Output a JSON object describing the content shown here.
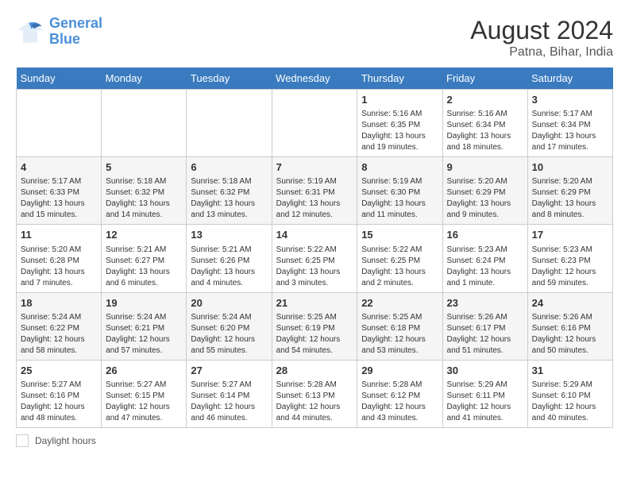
{
  "logo": {
    "line1": "General",
    "line2": "Blue"
  },
  "title": "August 2024",
  "location": "Patna, Bihar, India",
  "days_of_week": [
    "Sunday",
    "Monday",
    "Tuesday",
    "Wednesday",
    "Thursday",
    "Friday",
    "Saturday"
  ],
  "weeks": [
    [
      {
        "num": "",
        "info": ""
      },
      {
        "num": "",
        "info": ""
      },
      {
        "num": "",
        "info": ""
      },
      {
        "num": "",
        "info": ""
      },
      {
        "num": "1",
        "info": "Sunrise: 5:16 AM\nSunset: 6:35 PM\nDaylight: 13 hours and 19 minutes."
      },
      {
        "num": "2",
        "info": "Sunrise: 5:16 AM\nSunset: 6:34 PM\nDaylight: 13 hours and 18 minutes."
      },
      {
        "num": "3",
        "info": "Sunrise: 5:17 AM\nSunset: 6:34 PM\nDaylight: 13 hours and 17 minutes."
      }
    ],
    [
      {
        "num": "4",
        "info": "Sunrise: 5:17 AM\nSunset: 6:33 PM\nDaylight: 13 hours and 15 minutes."
      },
      {
        "num": "5",
        "info": "Sunrise: 5:18 AM\nSunset: 6:32 PM\nDaylight: 13 hours and 14 minutes."
      },
      {
        "num": "6",
        "info": "Sunrise: 5:18 AM\nSunset: 6:32 PM\nDaylight: 13 hours and 13 minutes."
      },
      {
        "num": "7",
        "info": "Sunrise: 5:19 AM\nSunset: 6:31 PM\nDaylight: 13 hours and 12 minutes."
      },
      {
        "num": "8",
        "info": "Sunrise: 5:19 AM\nSunset: 6:30 PM\nDaylight: 13 hours and 11 minutes."
      },
      {
        "num": "9",
        "info": "Sunrise: 5:20 AM\nSunset: 6:29 PM\nDaylight: 13 hours and 9 minutes."
      },
      {
        "num": "10",
        "info": "Sunrise: 5:20 AM\nSunset: 6:29 PM\nDaylight: 13 hours and 8 minutes."
      }
    ],
    [
      {
        "num": "11",
        "info": "Sunrise: 5:20 AM\nSunset: 6:28 PM\nDaylight: 13 hours and 7 minutes."
      },
      {
        "num": "12",
        "info": "Sunrise: 5:21 AM\nSunset: 6:27 PM\nDaylight: 13 hours and 6 minutes."
      },
      {
        "num": "13",
        "info": "Sunrise: 5:21 AM\nSunset: 6:26 PM\nDaylight: 13 hours and 4 minutes."
      },
      {
        "num": "14",
        "info": "Sunrise: 5:22 AM\nSunset: 6:25 PM\nDaylight: 13 hours and 3 minutes."
      },
      {
        "num": "15",
        "info": "Sunrise: 5:22 AM\nSunset: 6:25 PM\nDaylight: 13 hours and 2 minutes."
      },
      {
        "num": "16",
        "info": "Sunrise: 5:23 AM\nSunset: 6:24 PM\nDaylight: 13 hours and 1 minute."
      },
      {
        "num": "17",
        "info": "Sunrise: 5:23 AM\nSunset: 6:23 PM\nDaylight: 12 hours and 59 minutes."
      }
    ],
    [
      {
        "num": "18",
        "info": "Sunrise: 5:24 AM\nSunset: 6:22 PM\nDaylight: 12 hours and 58 minutes."
      },
      {
        "num": "19",
        "info": "Sunrise: 5:24 AM\nSunset: 6:21 PM\nDaylight: 12 hours and 57 minutes."
      },
      {
        "num": "20",
        "info": "Sunrise: 5:24 AM\nSunset: 6:20 PM\nDaylight: 12 hours and 55 minutes."
      },
      {
        "num": "21",
        "info": "Sunrise: 5:25 AM\nSunset: 6:19 PM\nDaylight: 12 hours and 54 minutes."
      },
      {
        "num": "22",
        "info": "Sunrise: 5:25 AM\nSunset: 6:18 PM\nDaylight: 12 hours and 53 minutes."
      },
      {
        "num": "23",
        "info": "Sunrise: 5:26 AM\nSunset: 6:17 PM\nDaylight: 12 hours and 51 minutes."
      },
      {
        "num": "24",
        "info": "Sunrise: 5:26 AM\nSunset: 6:16 PM\nDaylight: 12 hours and 50 minutes."
      }
    ],
    [
      {
        "num": "25",
        "info": "Sunrise: 5:27 AM\nSunset: 6:16 PM\nDaylight: 12 hours and 48 minutes."
      },
      {
        "num": "26",
        "info": "Sunrise: 5:27 AM\nSunset: 6:15 PM\nDaylight: 12 hours and 47 minutes."
      },
      {
        "num": "27",
        "info": "Sunrise: 5:27 AM\nSunset: 6:14 PM\nDaylight: 12 hours and 46 minutes."
      },
      {
        "num": "28",
        "info": "Sunrise: 5:28 AM\nSunset: 6:13 PM\nDaylight: 12 hours and 44 minutes."
      },
      {
        "num": "29",
        "info": "Sunrise: 5:28 AM\nSunset: 6:12 PM\nDaylight: 12 hours and 43 minutes."
      },
      {
        "num": "30",
        "info": "Sunrise: 5:29 AM\nSunset: 6:11 PM\nDaylight: 12 hours and 41 minutes."
      },
      {
        "num": "31",
        "info": "Sunrise: 5:29 AM\nSunset: 6:10 PM\nDaylight: 12 hours and 40 minutes."
      }
    ]
  ],
  "footer": {
    "label": "Daylight hours"
  }
}
